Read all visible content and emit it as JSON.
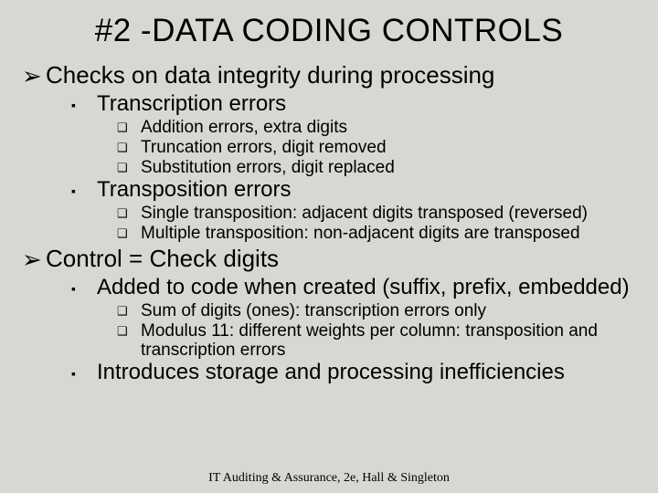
{
  "title": "#2 -DATA CODING CONTROLS",
  "b1a": "Checks on data integrity during processing",
  "b1a_1": "Transcription errors",
  "b1a_1_i": "Addition errors, extra digits",
  "b1a_1_ii": "Truncation errors, digit removed",
  "b1a_1_iii": "Substitution errors, digit replaced",
  "b1a_2": "Transposition errors",
  "b1a_2_i": "Single transposition: adjacent digits transposed (reversed)",
  "b1a_2_ii": "Multiple transposition: non-adjacent digits are transposed",
  "b1b": "Control = Check digits",
  "b1b_1": "Added to code when created (suffix, prefix, embedded)",
  "b1b_1_i": "Sum of digits (ones): transcription errors only",
  "b1b_1_ii": "Modulus 11: different weights per column: transposition and transcription errors",
  "b1b_2": "Introduces storage and processing inefficiencies",
  "footer": "IT Auditing & Assurance, 2e, Hall & Singleton"
}
